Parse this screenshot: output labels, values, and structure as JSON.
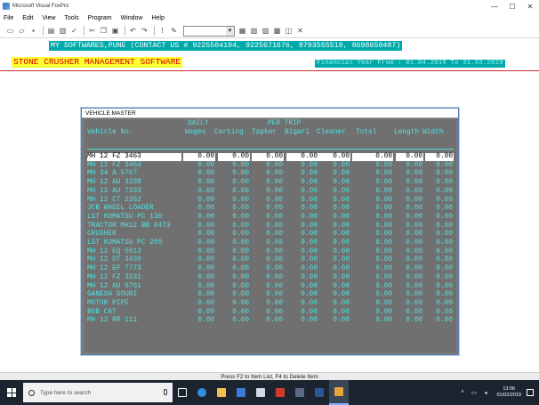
{
  "window": {
    "title": "Microsoft Visual FoxPro",
    "minimize": "—",
    "maximize": "☐",
    "close": "✕"
  },
  "menu": [
    "File",
    "Edit",
    "View",
    "Tools",
    "Program",
    "Window",
    "Help"
  ],
  "header": {
    "banner": "MY SOFTWARES,PUNE (CONTACT US # 9225504104, 9225671676, 8793555510, 8698650487)",
    "app_title": "STONE CRUSHER MANAGEMENT SOFTWARE",
    "financial_year": "Financial Year From : 01.04.2018 To 31.03.2019"
  },
  "vehicle_master": {
    "title": "VEHICLE MASTER",
    "headers": {
      "daily": "DAILY",
      "per_trip": "PER TRIP",
      "vehicle_no": "Vehicle No.",
      "wages": "Wages",
      "carting": "Carting",
      "tapker": "Tapker",
      "bigari": "Bigari",
      "cleaner": "Cleaner",
      "total": "Total",
      "length": "Length",
      "width": "Width"
    },
    "rows": [
      {
        "vehicle": "MH 12 FZ 3463",
        "wages": "0.00",
        "carting": "0.00",
        "tapker": "0.00",
        "bigari": "0.00",
        "cleaner": "0.00",
        "total": "0.00",
        "length": "0.00",
        "width": "0.00"
      },
      {
        "vehicle": "MH 12 FZ 3464",
        "wages": "0.00",
        "carting": "0.00",
        "tapker": "0.00",
        "bigari": "0.00",
        "cleaner": "0.00",
        "total": "0.00",
        "length": "0.00",
        "width": "0.00"
      },
      {
        "vehicle": "MH 34 A 5767",
        "wages": "0.00",
        "carting": "0.00",
        "tapker": "0.00",
        "bigari": "0.00",
        "cleaner": "0.00",
        "total": "0.00",
        "length": "0.00",
        "width": "0.00"
      },
      {
        "vehicle": "MH 12 AU 3338",
        "wages": "0.00",
        "carting": "0.00",
        "tapker": "0.00",
        "bigari": "0.00",
        "cleaner": "0.00",
        "total": "0.00",
        "length": "0.00",
        "width": "0.00"
      },
      {
        "vehicle": "MH 12 AU 7333",
        "wages": "0.00",
        "carting": "0.00",
        "tapker": "0.00",
        "bigari": "0.00",
        "cleaner": "0.00",
        "total": "0.00",
        "length": "0.00",
        "width": "0.00"
      },
      {
        "vehicle": "MH 12 CT 2262",
        "wages": "0.00",
        "carting": "0.00",
        "tapker": "0.00",
        "bigari": "0.00",
        "cleaner": "0.00",
        "total": "0.00",
        "length": "0.00",
        "width": "0.00"
      },
      {
        "vehicle": "JCB WHEEL LOADER",
        "wages": "0.00",
        "carting": "0.00",
        "tapker": "0.00",
        "bigari": "0.00",
        "cleaner": "0.00",
        "total": "0.00",
        "length": "0.00",
        "width": "0.00"
      },
      {
        "vehicle": "LST KOMATSU PC 130",
        "wages": "0.00",
        "carting": "0.00",
        "tapker": "0.00",
        "bigari": "0.00",
        "cleaner": "0.00",
        "total": "0.00",
        "length": "0.00",
        "width": "0.00"
      },
      {
        "vehicle": "TRACTOR MH12 BB 6473",
        "wages": "0.00",
        "carting": "0.00",
        "tapker": "0.00",
        "bigari": "0.00",
        "cleaner": "0.00",
        "total": "0.00",
        "length": "0.00",
        "width": "0.00"
      },
      {
        "vehicle": "CRUSHER",
        "wages": "0.00",
        "carting": "0.00",
        "tapker": "0.00",
        "bigari": "0.00",
        "cleaner": "0.00",
        "total": "0.00",
        "length": "0.00",
        "width": "0.00"
      },
      {
        "vehicle": "LST KOMATSU PC 200",
        "wages": "0.00",
        "carting": "0.00",
        "tapker": "0.00",
        "bigari": "0.00",
        "cleaner": "0.00",
        "total": "0.00",
        "length": "0.00",
        "width": "0.00"
      },
      {
        "vehicle": "MH 12 EQ 5913",
        "wages": "0.00",
        "carting": "0.00",
        "tapker": "0.00",
        "bigari": "0.00",
        "cleaner": "0.00",
        "total": "0.00",
        "length": "0.00",
        "width": "0.00"
      },
      {
        "vehicle": "MH 12 DT 3430",
        "wages": "0.00",
        "carting": "0.00",
        "tapker": "0.00",
        "bigari": "0.00",
        "cleaner": "0.00",
        "total": "0.00",
        "length": "0.00",
        "width": "0.00"
      },
      {
        "vehicle": "MH 12 EF 7773",
        "wages": "0.00",
        "carting": "0.00",
        "tapker": "0.00",
        "bigari": "0.00",
        "cleaner": "0.00",
        "total": "0.00",
        "length": "0.00",
        "width": "0.00"
      },
      {
        "vehicle": "MH 12 FZ 3231",
        "wages": "0.00",
        "carting": "0.00",
        "tapker": "0.00",
        "bigari": "0.00",
        "cleaner": "0.00",
        "total": "0.00",
        "length": "0.00",
        "width": "0.00"
      },
      {
        "vehicle": "MH 12 AU 6761",
        "wages": "0.00",
        "carting": "0.00",
        "tapker": "0.00",
        "bigari": "0.00",
        "cleaner": "0.00",
        "total": "0.00",
        "length": "0.00",
        "width": "0.00"
      },
      {
        "vehicle": "GANESH GOURI",
        "wages": "0.00",
        "carting": "0.00",
        "tapker": "0.00",
        "bigari": "0.00",
        "cleaner": "0.00",
        "total": "0.00",
        "length": "0.00",
        "width": "0.00"
      },
      {
        "vehicle": "MOTOR PIPE",
        "wages": "0.00",
        "carting": "0.00",
        "tapker": "0.00",
        "bigari": "0.00",
        "cleaner": "0.00",
        "total": "0.00",
        "length": "0.00",
        "width": "0.00"
      },
      {
        "vehicle": "BOB CAT",
        "wages": "0.00",
        "carting": "0.00",
        "tapker": "0.00",
        "bigari": "0.00",
        "cleaner": "0.00",
        "total": "0.00",
        "length": "0.00",
        "width": "0.00"
      },
      {
        "vehicle": "MH 12 RR 111",
        "wages": "0.00",
        "carting": "0.00",
        "tapker": "0.00",
        "bigari": "0.00",
        "cleaner": "0.00",
        "total": "0.00",
        "length": "0.00",
        "width": "0.00"
      }
    ]
  },
  "status_bar": "Press F2 to Item List, F4 to Delete Item",
  "taskbar": {
    "search_placeholder": "Type here to search",
    "time": "13:06",
    "date": "01/02/2019"
  },
  "colors": {
    "banner_bg": "#00a9a9",
    "title_bg": "#ffff33",
    "title_fg": "#d40000",
    "grid_bg": "#707070",
    "grid_fg": "#55e0e0"
  }
}
